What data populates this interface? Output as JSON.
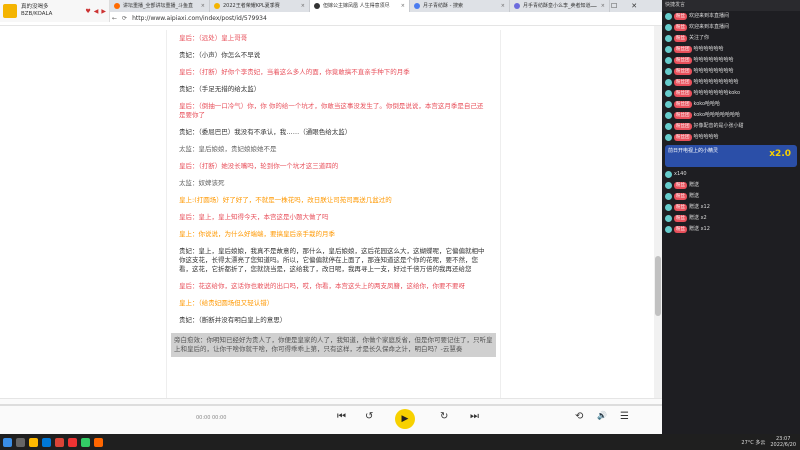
{
  "media_mini": {
    "title": "真的没喝多",
    "artist": "BZB/KOALA",
    "ctrl_heart": "♥",
    "ctrl_prev": "◀",
    "ctrl_next": "▶"
  },
  "tabs": [
    {
      "label": "讲坛重播_全部讲坛重播_斗鱼直",
      "active": false,
      "color": "#ff6a00"
    },
    {
      "label": "2022王者荣耀KPL夏季赛",
      "active": false,
      "color": "#f4b400"
    },
    {
      "label": "但嫁公主嫁凤凰 人生得意须尽",
      "active": true,
      "color": "#333333"
    },
    {
      "label": "月子青纺酥 - 搜索",
      "active": false,
      "color": "#4a7cf0"
    },
    {
      "label": "月手青纺酥皇小么李_卖者知道",
      "active": false,
      "color": "#6b6bdd"
    }
  ],
  "address": {
    "url": "http://www.aipiaxi.com/index/post/id/579934",
    "back": "←",
    "refresh": "⟳"
  },
  "window_controls": {
    "minimize": "—",
    "maximize": "☐",
    "close": "✕"
  },
  "script_lines": [
    {
      "text": "皇后：（远处）皇上哥哥",
      "color": "red"
    },
    {
      "text": "贵妃：（小声）你怎么不早说",
      "color": "dark"
    },
    {
      "text": "皇后：（打断）好你个李贵妃，当着这么多人的面，你竟敢搞不直亲手种下的月季",
      "color": "red"
    },
    {
      "text": "贵妃：（手足无措的给太监）",
      "color": "dark"
    },
    {
      "text": "皇后：（倒抽一口冷气）你，你 你的给一个坑才，你敢当这事没发生了。你倒是说说，本宫这月季是自己还是要你了",
      "color": "red"
    },
    {
      "text": "贵妃：（委屈巴巴）我没有不承认，我……（通眼色给太监）",
      "color": "dark"
    },
    {
      "text": "太监：皇后娘娘，贵妃娘娘她不是",
      "color": "gray"
    },
    {
      "text": "皇后：（打断）她没长嘴吗，轮到你一个坑才这三道四的",
      "color": "red"
    },
    {
      "text": "太监：奴婢该死",
      "color": "gray"
    },
    {
      "text": "皇上:(打圆场）好了好了，不就是一株花吗，改日朕让司苑司再送几盆过的",
      "color": "orange"
    },
    {
      "text": "皇后：皇上，皇上知得今天，本宫这是小题大做了吗",
      "color": "red"
    },
    {
      "text": "皇上：你说说，为什么好端端，要搞皇后亲手栽的月季",
      "color": "orange"
    },
    {
      "text": "贵妃：皇上，皇后娘娘，我真不是故意的，那什么，皇后娘娘，这后花园这么大，这蝴蝶呢，它偏偏就相中你这支花，长得太漂亮了您知道吗。所以，它偏偏就停在上面了，那连知道这是个你的花呢，要不然，您看，这花，它折都折了，您就饶当是，这给我了，改日呢，我再寻上一支，好过千倍万倍的我再还给您",
      "color": "dark"
    },
    {
      "text": "皇后：花这给你，这话你也敢说的出口吗，哎，你看，本宫这头上的两支凤簪，这给你，你要不要呀",
      "color": "red"
    },
    {
      "text": "皇上：（给贵妃圆场但又轻认错）",
      "color": "orange"
    },
    {
      "text": "贵妃：（断断并没有明白皇上的意思）",
      "color": "dark"
    },
    {
      "text": "旁白愈效：你明知已经好为贵人了，你便是皇家的人了，我知道，你做个家庭反省，但是你可要记住了，只听皇上和皇后的，让你干啥你就干啥，你可得乖乖上第，只有这样，才是长久保命之计，明白吗？-云慧奏",
      "color": "hl"
    }
  ],
  "player": {
    "time_current": "00:00",
    "time_total": "00:00",
    "progress": 0,
    "ctrl_prev": "⏮",
    "ctrl_back15": "↺",
    "ctrl_play": "▶",
    "ctrl_fwd15": "↻",
    "ctrl_next": "⏭",
    "ctrl_loop": "⟲",
    "ctrl_volume": "🔊",
    "ctrl_list": "☰"
  },
  "chat": {
    "header": "快捷发言",
    "messages": [
      {
        "badge": "粉丝",
        "name": "",
        "text": "欢迎来到本直播间"
      },
      {
        "badge": "粉丝",
        "name": "",
        "text": "欢迎来到本直播间"
      },
      {
        "badge": "粉丝",
        "name": "",
        "text": "关注了你"
      },
      {
        "badge": "粉丝团",
        "name": "",
        "text": "哈哈哈哈哈哈"
      },
      {
        "badge": "粉丝团",
        "name": "",
        "text": "哈哈哈哈哈哈哈哈"
      },
      {
        "badge": "粉丝团",
        "name": "",
        "text": "哈哈哈哈哈哈哈哈"
      },
      {
        "badge": "粉丝团",
        "name": "",
        "text": "哈哈哈哈哈哈哈哈哈"
      },
      {
        "badge": "粉丝团",
        "name": "",
        "text": "哈哈哈哈哈哈哈koko"
      },
      {
        "badge": "粉丝团",
        "name": "",
        "text": "koko哈哈哈"
      },
      {
        "badge": "粉丝团",
        "name": "",
        "text": "koko哈哈哈哈哈哈哈"
      },
      {
        "badge": "粉丝团",
        "name": "",
        "text": "好像配音的是小张小甜"
      },
      {
        "badge": "粉丝团",
        "name": "",
        "text": "哈哈哈哈哈"
      }
    ],
    "gift_text": "前日开电视上的小精灵",
    "gift_multiplier": "x2.0",
    "tail_messages": [
      {
        "badge": "",
        "name": "",
        "text": "x140"
      },
      {
        "badge": "粉丝",
        "name": "",
        "text": "赠送"
      },
      {
        "badge": "粉丝",
        "name": "",
        "text": "赠送"
      },
      {
        "badge": "粉丝",
        "name": "",
        "text": "赠送 x12"
      },
      {
        "badge": "粉丝",
        "name": "",
        "text": "赠送 x2"
      },
      {
        "badge": "粉丝",
        "name": "",
        "text": "赠送 x12"
      }
    ]
  },
  "tray": {
    "weather": "27°C 多云",
    "time": "23:07",
    "date": "2022/6/20"
  }
}
